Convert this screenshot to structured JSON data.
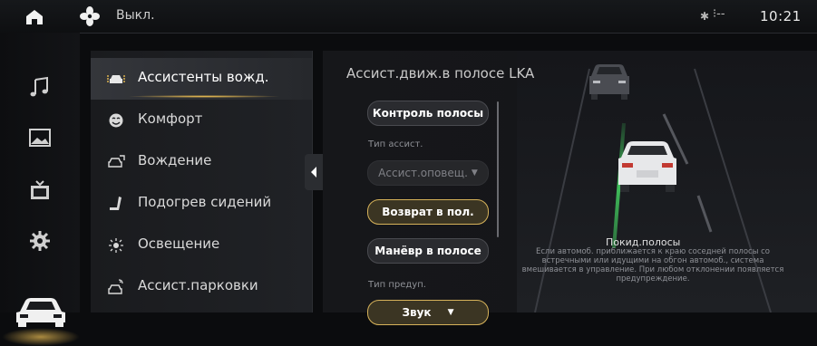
{
  "status_bar": {
    "fan_text": "Выкл.",
    "bluetooth_icon": "bluetooth-icon",
    "signal_text": "⁝--",
    "time": "10:21"
  },
  "rail": {
    "icons": [
      "music-icon",
      "gallery-icon",
      "video-icon",
      "settings-icon",
      "car-icon"
    ]
  },
  "menu": {
    "items": [
      {
        "icon": "driver-assist-icon",
        "label": "Ассистенты вожд."
      },
      {
        "icon": "comfort-icon",
        "label": "Комфорт"
      },
      {
        "icon": "driving-icon",
        "label": "Вождение"
      },
      {
        "icon": "seat-heating-icon",
        "label": "Подогрев сидений"
      },
      {
        "icon": "lighting-icon",
        "label": "Освещение"
      },
      {
        "icon": "parking-assist-icon",
        "label": "Ассист.парковки"
      }
    ]
  },
  "content": {
    "title": "Ассист.движ.в полосе LKA",
    "lane_control_button": "Контроль полосы",
    "assist_type_label": "Тип ассист.",
    "assist_type_value": "Ассист.оповещ.",
    "return_lane_button": "Возврат в пол.",
    "lane_maneuver_button": "Манёвр в полосе",
    "warning_type_label": "Тип предуп.",
    "warning_type_value": "Звук",
    "description_title": "Покид.полосы",
    "description_text": "Если автомоб. приближается к краю соседней полосы со встречными или идущими на обгон автомоб., система вмешивается в управление. При любом отклонении появляется предупреждение."
  },
  "colors": {
    "accent_gold": "#d6b25a",
    "lane_green": "#3fbf5a"
  }
}
